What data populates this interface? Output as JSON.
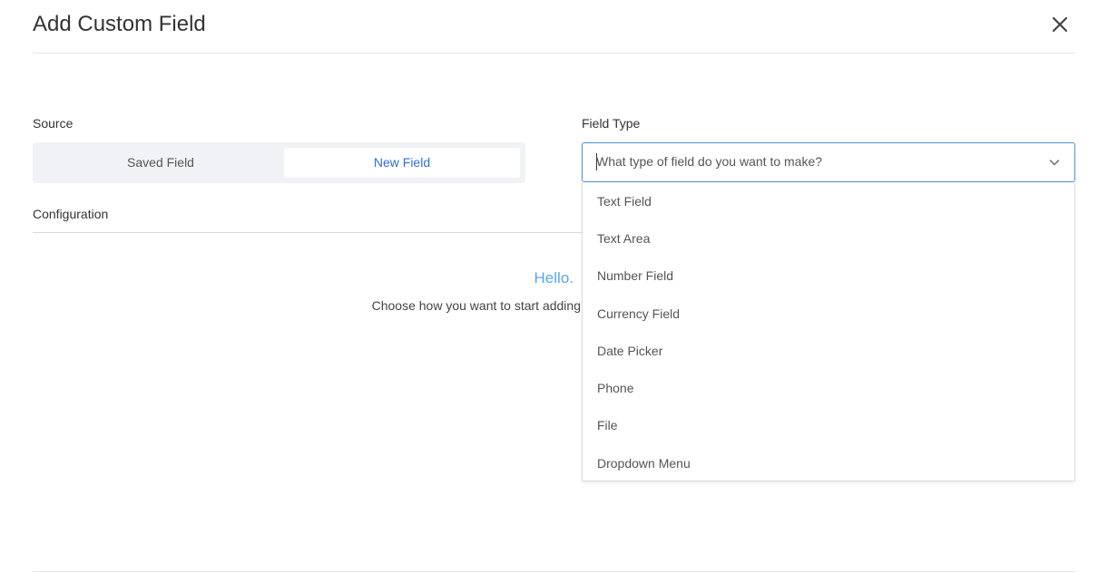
{
  "modal": {
    "title": "Add Custom Field"
  },
  "source": {
    "label": "Source",
    "options": [
      {
        "label": "Saved Field",
        "selected": false
      },
      {
        "label": "New Field",
        "selected": true
      }
    ]
  },
  "configuration": {
    "label": "Configuration",
    "greeting": "Hello.",
    "prompt": "Choose how you want to start adding"
  },
  "field_type": {
    "label": "Field Type",
    "placeholder": "What type of field do you want to make?",
    "options": [
      "Text Field",
      "Text Area",
      "Number Field",
      "Currency Field",
      "Date Picker",
      "Phone",
      "File",
      "Dropdown Menu"
    ]
  },
  "colors": {
    "accent": "#2f6fd6",
    "focus_border": "#4a90d9",
    "greeting": "#5aa7e4",
    "toggle_bg": "#f0f2f5"
  },
  "icons": {
    "close": "close-icon",
    "dropdown": "chevron-down-icon"
  }
}
